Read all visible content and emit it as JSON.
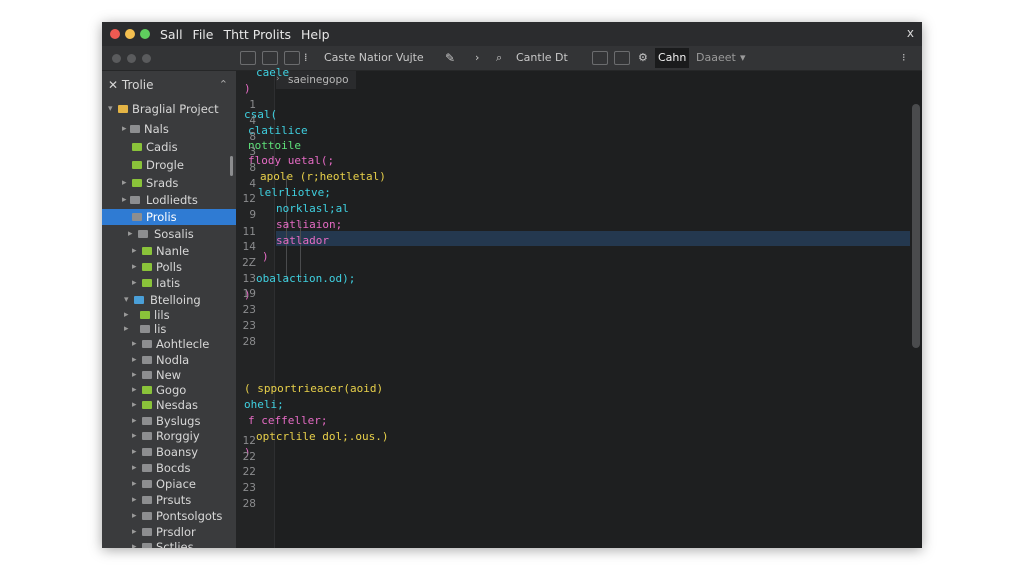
{
  "window": {
    "menu": [
      "Sall",
      "File",
      "Thtt Prolits",
      "Help"
    ],
    "close_glyph": "x"
  },
  "toolbar": {
    "search_text": "Caste Natior Vujte",
    "find_text": "Cantle Dt",
    "active_tab": "Cahn",
    "dropdown_text": "Daaeet"
  },
  "sidebar": {
    "title": "Trolie",
    "items": [
      {
        "label": "Braglial Project",
        "arrow": "▾"
      },
      {
        "label": "Nals",
        "arrow": "▸"
      },
      {
        "label": "Cadis",
        "arrow": ""
      },
      {
        "label": "Drogle",
        "arrow": ""
      },
      {
        "label": "Srads",
        "arrow": "▸"
      },
      {
        "label": "Lodliedts",
        "arrow": "▸"
      },
      {
        "label": "Prolis",
        "arrow": ""
      },
      {
        "label": "Sosalis",
        "arrow": "▸"
      },
      {
        "label": "Nanle",
        "arrow": "▸"
      },
      {
        "label": "Polls",
        "arrow": "▸"
      },
      {
        "label": "Iatis",
        "arrow": "▸"
      },
      {
        "label": "Btelloing",
        "arrow": "▾"
      },
      {
        "label": "lils",
        "arrow": "▸"
      },
      {
        "label": "lis",
        "arrow": "▸"
      },
      {
        "label": "Aohtlecle",
        "arrow": "▸"
      },
      {
        "label": "Nodla",
        "arrow": "▸"
      },
      {
        "label": "New",
        "arrow": "▸"
      },
      {
        "label": "Gogo",
        "arrow": "▸"
      },
      {
        "label": "Nesdas",
        "arrow": "▸"
      },
      {
        "label": "Byslugs",
        "arrow": "▸"
      },
      {
        "label": "Rorggiy",
        "arrow": "▸"
      },
      {
        "label": "Boansy",
        "arrow": "▸"
      },
      {
        "label": "Bocds",
        "arrow": "▸"
      },
      {
        "label": "Opiace",
        "arrow": "▸"
      },
      {
        "label": "Prsuts",
        "arrow": "▸"
      },
      {
        "label": "Pontsolgots",
        "arrow": "▸"
      },
      {
        "label": "Prsdlor",
        "arrow": "▸"
      },
      {
        "label": "Sctlies",
        "arrow": "▸"
      }
    ]
  },
  "editor": {
    "tab_label": "saeinegopo",
    "line_numbers": [
      "1",
      "4",
      "8",
      "3",
      "8",
      "4",
      "12",
      "9",
      "11",
      "14",
      "2Z",
      "13",
      "19",
      "23",
      "23",
      "28",
      "12",
      "22",
      "22",
      "23",
      "28"
    ],
    "lines": [
      {
        "text": "caele",
        "color": "#3fd0e0"
      },
      {
        "text": ")",
        "color": "#e56bc4"
      },
      {
        "text": "csal(",
        "color": "#3fd0e0"
      },
      {
        "text": "clatilice",
        "color": "#3fd0e0"
      },
      {
        "text": "nottoile",
        "color": "#5ee27a"
      },
      {
        "text": "flody uetal(;",
        "color": "#e56bc4"
      },
      {
        "text": "apole (r;heotletal)",
        "color": "#e8d04a"
      },
      {
        "text": "lelrliotve;",
        "color": "#3fd0e0"
      },
      {
        "text": "norklasl;al",
        "color": "#3fd0e0"
      },
      {
        "text": "satliaion;",
        "color": "#e56bc4"
      },
      {
        "text": "satlador",
        "color": "#e56bc4"
      },
      {
        "text": ")",
        "color": "#e56bc4"
      },
      {
        "text": "obalaction.od);",
        "color": "#3fd0e0"
      },
      {
        "text": ")",
        "color": "#e56bc4"
      },
      {
        "text": "( spportrieacer(aoid)",
        "color": "#e8d04a"
      },
      {
        "text": "oheli;",
        "color": "#3fd0e0"
      },
      {
        "text": "f ceffeller;",
        "color": "#e56bc4"
      },
      {
        "text": "optcrlile dol;.ous.)",
        "color": "#e8d04a"
      },
      {
        "text": ")",
        "color": "#e56bc4"
      }
    ]
  }
}
